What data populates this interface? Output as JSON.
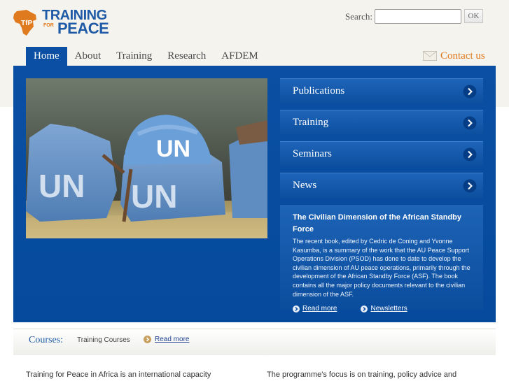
{
  "logo": {
    "word1": "TRAINING",
    "for": "FOR",
    "word2": "PEACE",
    "badge": "TfP"
  },
  "search": {
    "label": "Search:",
    "value": "",
    "button": "OK"
  },
  "nav": {
    "items": [
      "Home",
      "About",
      "Training",
      "Research",
      "AFDEM"
    ],
    "active": "Home",
    "contact": "Contact us"
  },
  "hero": {
    "image_icon": "un-peacekeeping-helmet-and-vests-photo",
    "image_text": "UN"
  },
  "sidebar": {
    "items": [
      "Publications",
      "Training",
      "Seminars",
      "News"
    ]
  },
  "feature": {
    "title": "The Civilian Dimension of the African Standby Force",
    "body": "The recent book, edited by Cedric de Coning and Yvonne Kasumba, is a summary of the work that the AU Peace Support Operations Division (PSOD) has done to date to develop the civilian dimension of AU peace operations, primarily through the development of the African Standby Force (ASF). The book contains all the major policy documents relevant to the civilian dimension of the ASF.",
    "read_more": "Read more",
    "newsletters": "Newsletters"
  },
  "courses": {
    "label": "Courses:",
    "training_courses": "Training Courses",
    "read_more": "Read more"
  },
  "intro": {
    "left": "Training for Peace in Africa is an international capacity",
    "right": "The programme's focus is on training, policy advice and"
  },
  "colors": {
    "brand_blue": "#0a4fa3",
    "accent_orange": "#e07a1f",
    "top_band": "#f4f3ee"
  }
}
